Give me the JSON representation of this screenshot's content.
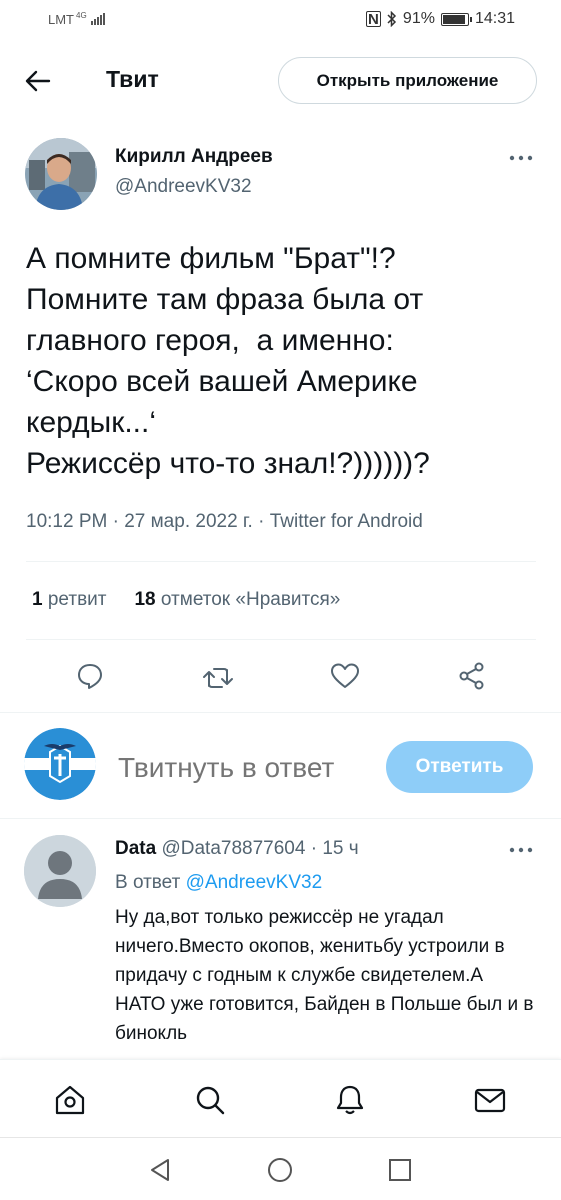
{
  "status_bar": {
    "carrier": "LMT",
    "network": "4G",
    "battery_percent": "91%",
    "battery_level": 0.91,
    "time": "14:31"
  },
  "header": {
    "title": "Твит",
    "open_app_label": "Открыть приложение"
  },
  "tweet": {
    "author_name": "Кирилл Андреев",
    "author_handle": "@AndreevKV32",
    "text": "А помните фильм \"Брат\"!?\nПомните там фраза была от\nглавного героя,  а именно:\n‘Скоро всей вашей Америке\nкердык...‘\nРежиссёр что-то знал!?))))))?",
    "meta": "10:12 PM · 27 мар. 2022 г. · Twitter for Android",
    "retweets_count": "1",
    "retweets_label": "ретвит",
    "likes_count": "18",
    "likes_label": "отметок «Нравится»"
  },
  "composer": {
    "placeholder": "Твитнуть в ответ",
    "reply_button": "Ответить"
  },
  "reply": {
    "name": "Data",
    "handle": "@Data78877604",
    "time": "15 ч",
    "reply_to_prefix": "В ответ",
    "reply_to_handle": "@AndreevKV32",
    "text": "Ну да,вот только режиссёр не угадал ничего.Вместо окопов, женитьбу устроили в придачу с годным к службе свидетелем.А НАТО уже готовится, Байден в Польше был и в бинокль"
  },
  "colors": {
    "accent": "#1d9bf0",
    "reply_button_disabled": "#8ecdf8",
    "secondary_text": "#536471"
  }
}
